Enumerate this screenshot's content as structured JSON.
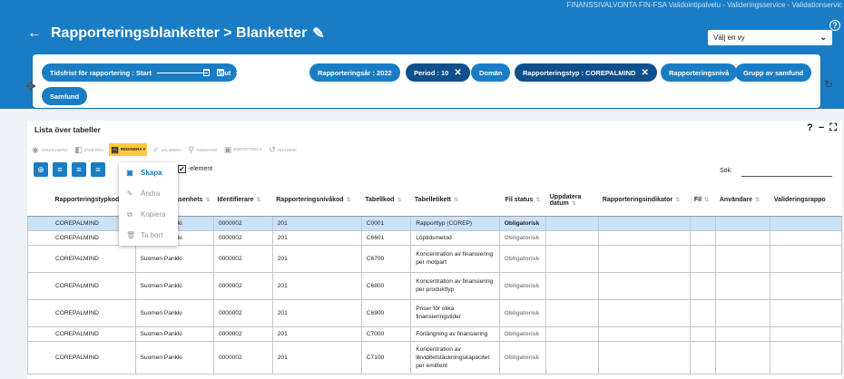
{
  "header": {
    "top_info": "FINANSSIVALVONTA FIN-FSA Validointipalvelu - Valideringsservice - Validationservic",
    "help_icon": "?",
    "back_icon": "←",
    "title": "Rapporteringsblanketter > Blanketter",
    "edit_icon": "✎",
    "view_select": {
      "value": "Välj en vy",
      "chevron": "⌄"
    }
  },
  "filters": {
    "drag_icon": "✥",
    "refresh_icon": "↻",
    "chips": [
      {
        "label": "Tidsfrist för rapportering : Start",
        "style": "normal"
      },
      {
        "label": "Slut",
        "style": "normal"
      },
      {
        "label": "Rapporteringsår : 2022",
        "style": "normal"
      },
      {
        "label": "Period : 10",
        "style": "dark",
        "close": "✕"
      },
      {
        "label": "Domän",
        "style": "normal"
      },
      {
        "label": "Rapporteringstyp : COREPALMIND",
        "style": "dark",
        "close": "✕"
      },
      {
        "label": "Rapporteringsnivå",
        "style": "normal"
      },
      {
        "label": "Grupp av samfund",
        "style": "normal"
      },
      {
        "label": "Samfund",
        "style": "normal"
      }
    ]
  },
  "card": {
    "title": "Lista över tabeller",
    "controls": {
      "help": "?",
      "minimize": "−",
      "expand": "⛶"
    },
    "toolbar": [
      {
        "label": "VISUALISERA",
        "icon": "eye-icon"
      },
      {
        "label": "JÄMFÖRA",
        "icon": "compare-icon"
      },
      {
        "label": "REDIGERA ▾",
        "icon": "edit-doc-icon",
        "active": true
      },
      {
        "label": "VALIDERA",
        "icon": "check-icon"
      },
      {
        "label": "GODKÄNN",
        "icon": "approve-icon"
      },
      {
        "label": "EXPORTERA ▾",
        "icon": "export-icon"
      },
      {
        "label": "HISTORIK",
        "icon": "history-icon"
      }
    ],
    "buttons": [
      "⊕",
      "≡",
      "≡",
      "≡"
    ],
    "checkbox_label": "-element",
    "checkbox_state": "✔",
    "search_label": "Sök:"
  },
  "dropdown": [
    {
      "label": "Skapa",
      "icon": "▣",
      "enabled": true
    },
    {
      "label": "Ändra",
      "icon": "✎",
      "enabled": false
    },
    {
      "label": "Kopiera",
      "icon": "⧉",
      "enabled": false
    },
    {
      "label": "Ta bort",
      "icon": "🗑",
      "enabled": false
    }
  ],
  "table": {
    "columns": [
      "Rapporteringstypkod",
      "Rapporteringsenhets",
      "Identifierare",
      "Rapporteringsnivåkod",
      "Tabellkod",
      "Tabelletikett",
      "Fil status",
      "Uppdatera datum",
      "Rapporteringsindikator",
      "Fil",
      "Användare",
      "Valideringsrappo"
    ],
    "rows": [
      [
        "COREPALMIND",
        "Suomen Pankki",
        "0000002",
        "201",
        "C0001",
        "Rapporttyp (COREP)",
        "Obligatorisk"
      ],
      [
        "COREPALMIND",
        "Suomen Pankki",
        "0000002",
        "201",
        "C6601",
        "Löptidsmetod",
        "Obligatorisk"
      ],
      [
        "COREPALMIND",
        "Suomen Pankki",
        "0000002",
        "201",
        "C6700",
        "Koncentration av finansiering per motpart",
        "Obligatorisk"
      ],
      [
        "COREPALMIND",
        "Suomen Pankki",
        "0000002",
        "201",
        "C6800",
        "Koncentration av finansiering per produkttyp",
        "Obligatorisk"
      ],
      [
        "COREPALMIND",
        "Suomen Pankki",
        "0000002",
        "201",
        "C6900",
        "Priser för olika finansieringstider",
        "Obligatorisk"
      ],
      [
        "COREPALMIND",
        "Suomen Pankki",
        "0000002",
        "201",
        "C7000",
        "Förlängning av finansiering",
        "Obligatorisk"
      ],
      [
        "COREPALMIND",
        "Suomen Pankki",
        "0000002",
        "201",
        "C7100",
        "Koncentration av likviditetstäckningskapacitet per emittent",
        "Obligatorisk"
      ]
    ]
  }
}
